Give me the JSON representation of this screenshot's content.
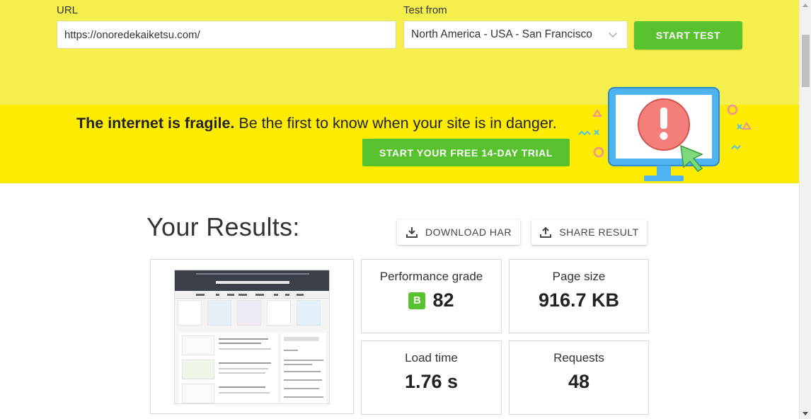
{
  "form": {
    "url_label": "URL",
    "url_value": "https://onoredekaiketsu.com/",
    "from_label": "Test from",
    "location_selected": "North America - USA - San Francisco",
    "start_button": "START TEST"
  },
  "banner": {
    "headline_bold": "The internet is fragile.",
    "headline_rest": " Be the first to know when your site is in danger.",
    "trial_button": "START YOUR FREE 14-DAY TRIAL",
    "illustration": "monitor-alert-icon"
  },
  "results": {
    "title": "Your Results:",
    "download_har": "DOWNLOAD HAR",
    "share_result": "SHARE RESULT",
    "metrics": [
      {
        "label": "Performance grade",
        "grade": "B",
        "value": "82"
      },
      {
        "label": "Page size",
        "value": "916.7 KB"
      },
      {
        "label": "Load time",
        "value": "1.76 s"
      },
      {
        "label": "Requests",
        "value": "48"
      }
    ]
  },
  "colors": {
    "top_bg": "#f5ef4e",
    "banner_bg": "#fdec02",
    "accent_green": "#58c22e"
  },
  "icons": {
    "select_chevron": "chevron-down-icon",
    "download": "download-icon",
    "share": "share-icon"
  }
}
